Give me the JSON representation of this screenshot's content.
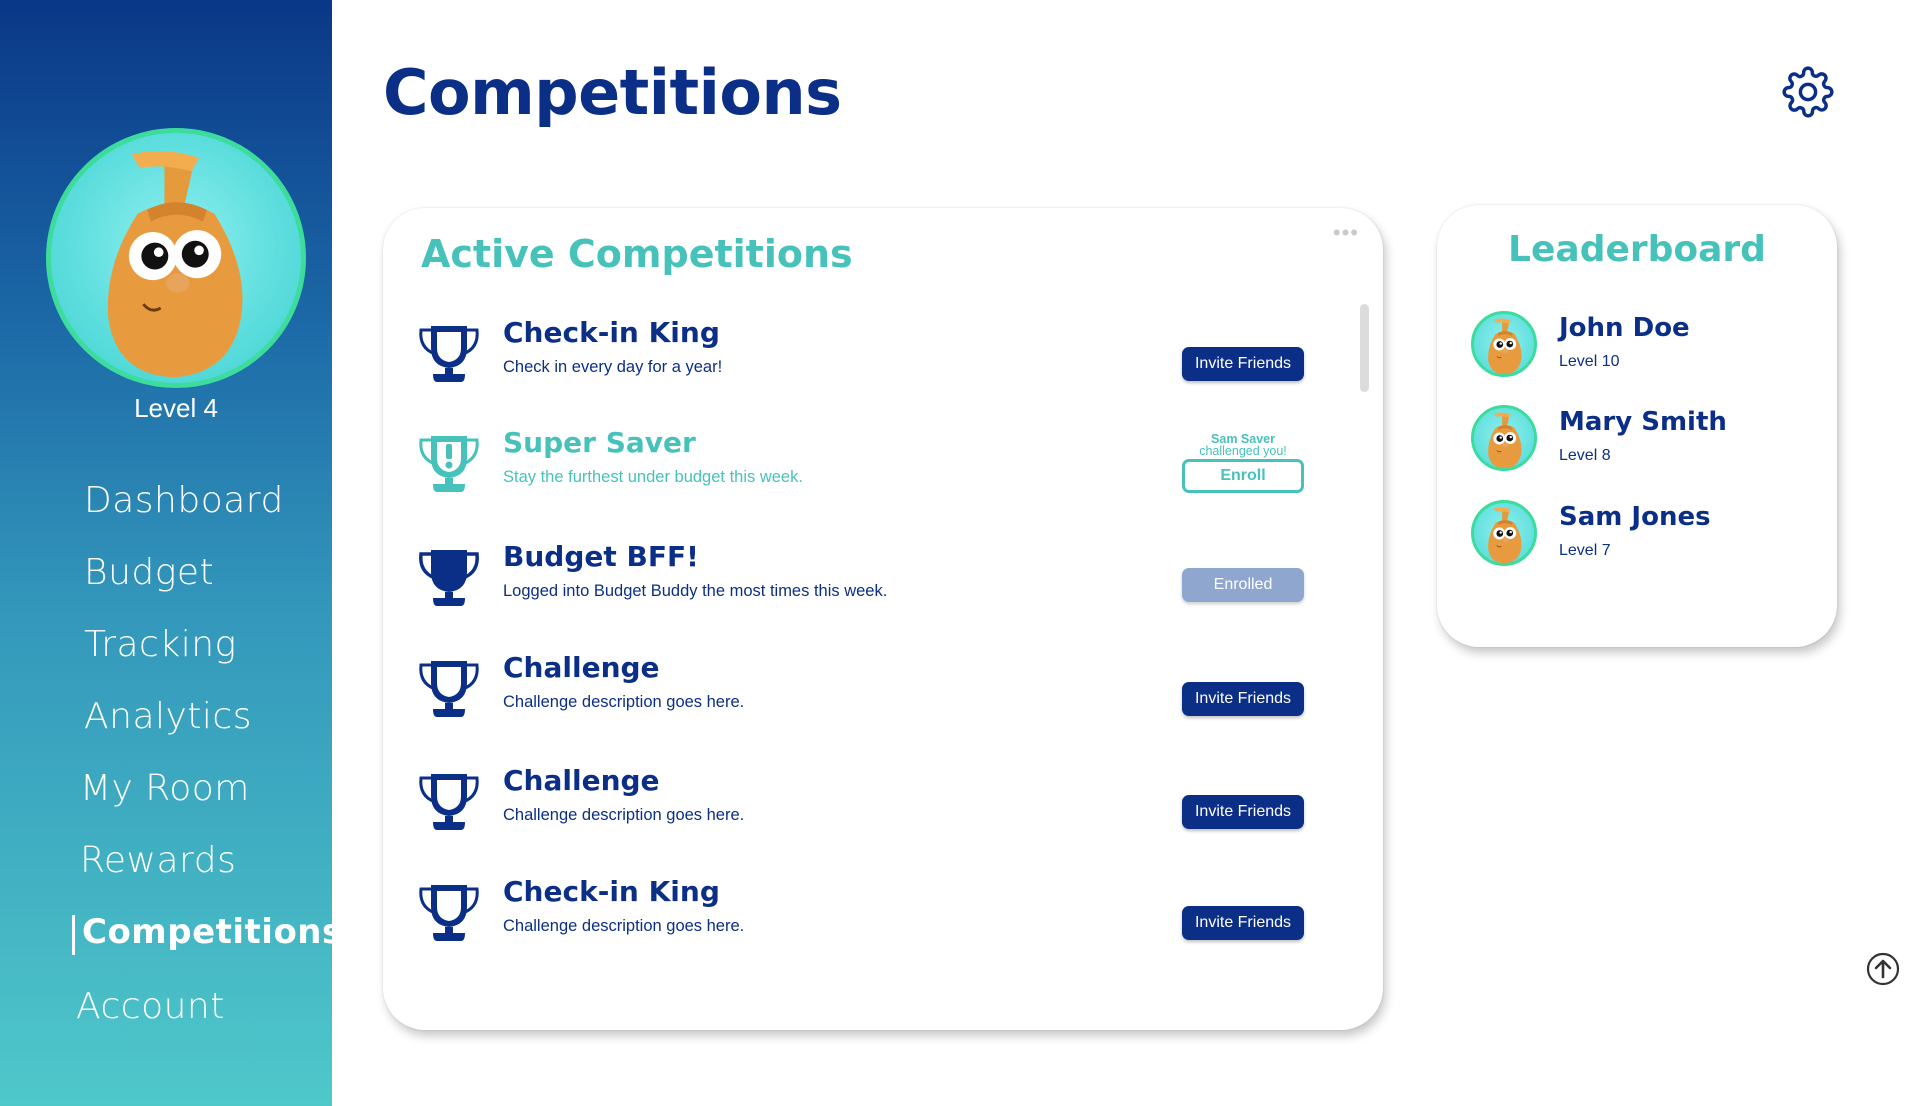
{
  "sidebar": {
    "level": "Level 4",
    "nav": [
      {
        "label": "Dashboard"
      },
      {
        "label": "Budget"
      },
      {
        "label": "Tracking"
      },
      {
        "label": "Analytics"
      },
      {
        "label": "My Room"
      },
      {
        "label": "Rewards"
      },
      {
        "label": "Competitions",
        "active": true
      },
      {
        "label": "Account"
      }
    ]
  },
  "header": {
    "title": "Competitions",
    "settings_icon": "gear-icon"
  },
  "competitions": {
    "title": "Active Competitions",
    "menu": "•••",
    "items": [
      {
        "name": "Check-in King",
        "description": "Check in every day for a year!",
        "action": "Invite Friends",
        "icon": "trophy-outline-icon"
      },
      {
        "name": "Super Saver",
        "description": "Stay the furthest under budget this week.",
        "action": "Enroll",
        "challenger": "Sam Saver",
        "challenge_text": "challenged you!",
        "icon": "trophy-exclamation-icon"
      },
      {
        "name": "Budget BFF!",
        "description": "Logged into Budget Buddy the most times this week.",
        "action": "Enrolled",
        "icon": "trophy-solid-icon"
      },
      {
        "name": "Challenge",
        "description": "Challenge description goes here.",
        "action": "Invite Friends",
        "icon": "trophy-outline-icon"
      },
      {
        "name": "Challenge",
        "description": "Challenge description goes here.",
        "action": "Invite Friends",
        "icon": "trophy-outline-icon"
      },
      {
        "name": "Check-in King",
        "description": "Challenge description goes here.",
        "action": "Invite Friends",
        "icon": "trophy-outline-icon"
      }
    ]
  },
  "leaderboard": {
    "title": "Leaderboard",
    "entries": [
      {
        "name": "John Doe",
        "level": "Level 10"
      },
      {
        "name": "Mary Smith",
        "level": "Level 8"
      },
      {
        "name": "Sam Jones",
        "level": "Level 7"
      }
    ]
  },
  "colors": {
    "navy": "#0b2f86",
    "teal": "#46c2bb",
    "enrolled": "#8fa7cf"
  }
}
